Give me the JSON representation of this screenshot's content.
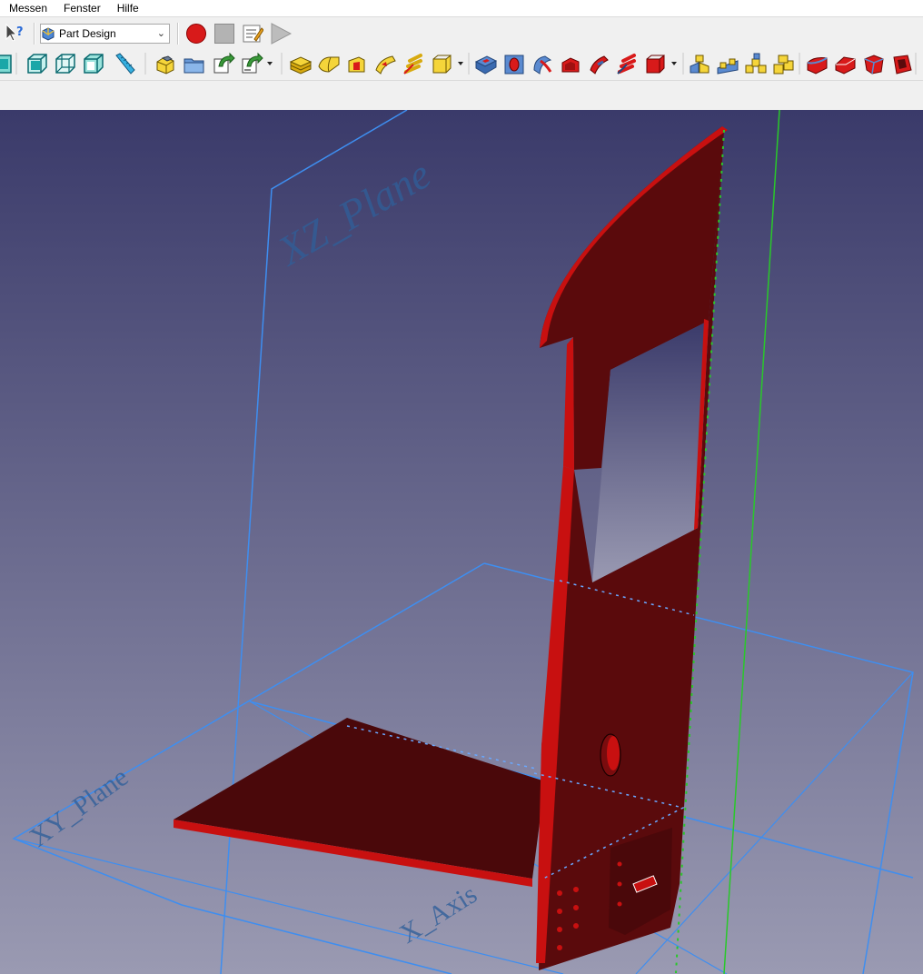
{
  "menu": [
    "Messen",
    "Fenster",
    "Hilfe"
  ],
  "workbench": {
    "selected": "Part Design"
  },
  "viewport": {
    "labels": {
      "xz_plane": "XZ_Plane",
      "xy_plane": "XY_Plane",
      "x_axis": "X_Axis"
    },
    "colors": {
      "bg_top": "#3a3a6a",
      "bg_bottom": "#9a9ab2",
      "plane": "#4aa0ff",
      "part": "#5a0a0c",
      "part_edge": "#c81010",
      "y_axis": "#29c82a"
    }
  },
  "icons": {
    "toolbar_macro": [
      "whats-this-icon",
      "record-macro-icon",
      "stop-macro-icon",
      "edit-macro-icon",
      "run-macro-icon"
    ],
    "toolbar_partdesign": [
      "box-view-icon",
      "wireframe-view-icon",
      "clip-view-icon",
      "measure-icon",
      "create-body-icon",
      "create-part-icon",
      "shape-binder-icon",
      "sub-shape-binder-icon",
      "pad-icon",
      "revolution-icon",
      "additive-loft-icon",
      "additive-pipe-icon",
      "additive-helix-icon",
      "additive-primitive-icon",
      "pocket-icon",
      "hole-icon",
      "groove-icon",
      "subtractive-loft-icon",
      "subtractive-pipe-icon",
      "subtractive-helix-icon",
      "subtractive-primitive-icon",
      "mirrored-icon",
      "linear-pattern-icon",
      "polar-pattern-icon",
      "multi-transform-icon",
      "fillet-icon",
      "chamfer-icon",
      "draft-icon",
      "thickness-icon"
    ]
  }
}
